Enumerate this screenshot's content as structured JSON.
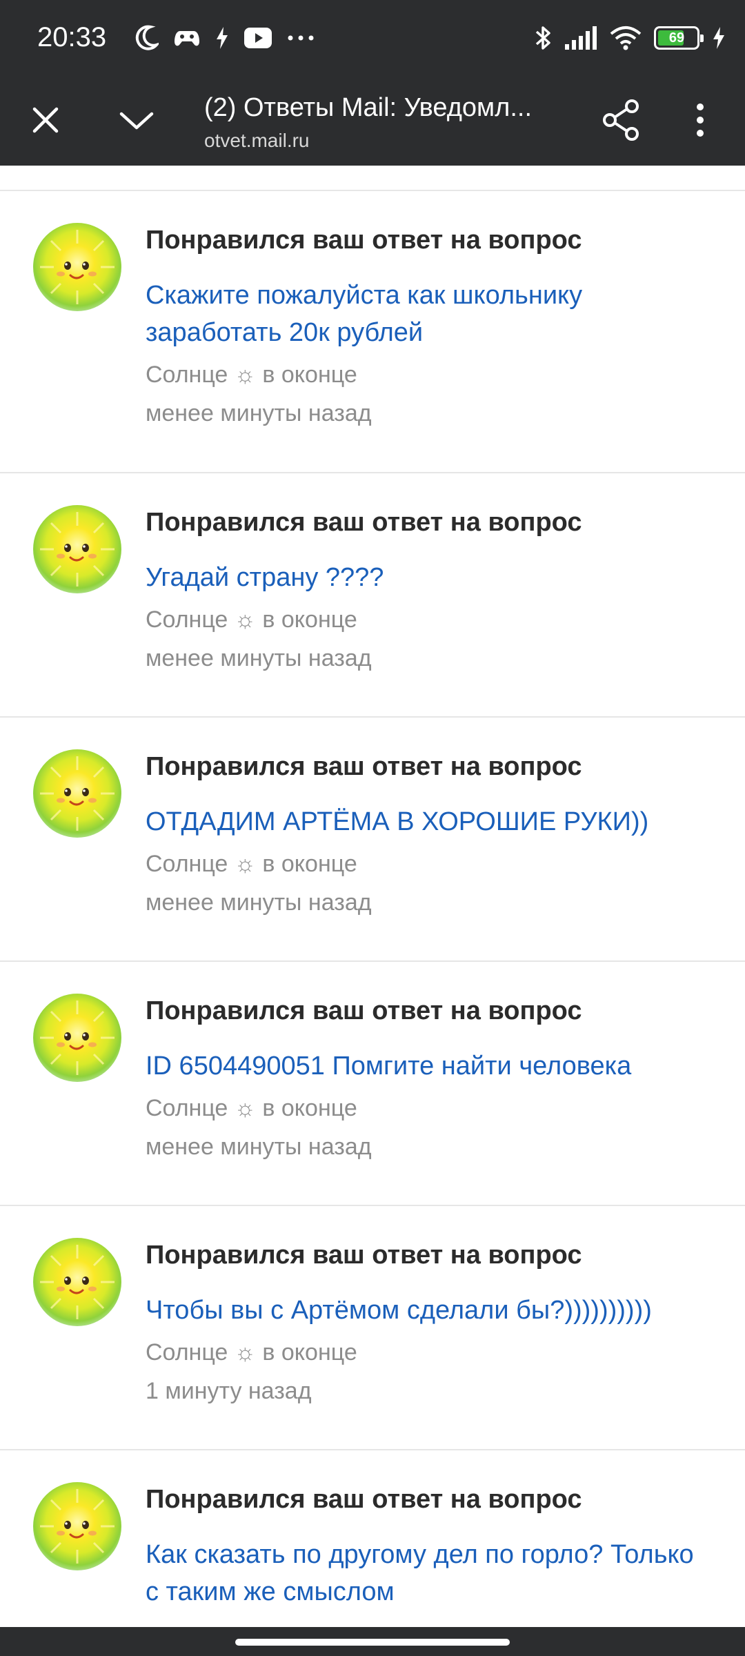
{
  "status_bar": {
    "time": "20:33",
    "left_icons": [
      "moon-icon",
      "gamepad-icon",
      "charging-bolt-icon",
      "youtube-icon",
      "more-dots-icon"
    ],
    "right_icons": [
      "bluetooth-icon",
      "signal-icon",
      "wifi-icon",
      "battery-icon",
      "charging-bolt-icon"
    ],
    "battery_level": "69",
    "battery_fraction": 0.69,
    "battery_color": "#3dbb3d"
  },
  "header": {
    "title": "(2) Ответы Mail: Уведомл...",
    "url": "otvet.mail.ru",
    "background": "#2c2d2f"
  },
  "notifications": [
    {
      "title": "Понравился ваш ответ на вопрос",
      "question": "Скажите пожалуйста как школьнику заработать 20к рублей",
      "author": "Солнце ☼ в оконце",
      "time": "менее минуты назад"
    },
    {
      "title": "Понравился ваш ответ на вопрос",
      "question": "Угадай страну ????",
      "author": "Солнце ☼ в оконце",
      "time": "менее минуты назад"
    },
    {
      "title": "Понравился ваш ответ на вопрос",
      "question": "ОТДАДИМ АРТЁМА В ХОРОШИЕ РУКИ))",
      "author": "Солнце ☼ в оконце",
      "time": "менее минуты назад"
    },
    {
      "title": "Понравился ваш ответ на вопрос",
      "question": "ID 6504490051 Помгите найти человека",
      "author": "Солнце ☼ в оконце",
      "time": "менее минуты назад"
    },
    {
      "title": "Понравился ваш ответ на вопрос",
      "question": "Чтобы вы с Артёмом сделали бы?))))))))))",
      "author": "Солнце ☼ в оконце",
      "time": "1 минуту назад"
    },
    {
      "title": "Понравился ваш ответ на вопрос",
      "question": "Как сказать по другому дел по горло? Только с таким же смыслом",
      "author": "",
      "time": ""
    }
  ],
  "colors": {
    "link": "#1a5fba",
    "title_text": "#2b2b2b",
    "muted_text": "#8c8c8c",
    "divider": "#e6e6e6",
    "chrome": "#2c2d2f"
  }
}
